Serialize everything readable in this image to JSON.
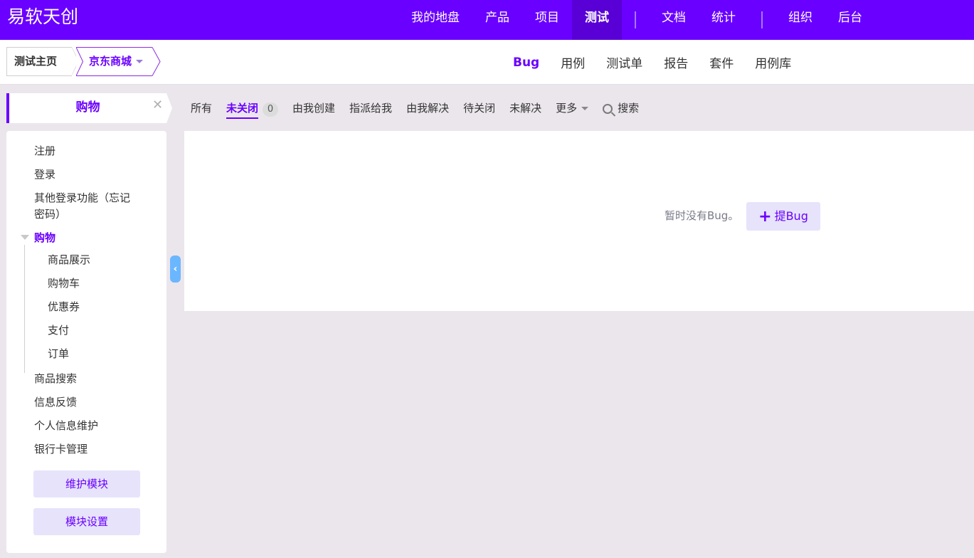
{
  "brand": "易软天创",
  "topnav": {
    "items": [
      "我的地盘",
      "产品",
      "项目",
      "测试",
      "文档",
      "统计",
      "组织",
      "后台"
    ],
    "active": "测试"
  },
  "breadcrumb": {
    "home": "测试主页",
    "product": "京东商城"
  },
  "subnav": {
    "items": [
      "Bug",
      "用例",
      "测试单",
      "报告",
      "套件",
      "用例库"
    ],
    "active": "Bug"
  },
  "module_panel": {
    "title": "购物",
    "tree": {
      "top_items": [
        "注册",
        "登录",
        "其他登录功能（忘记",
        "密码）"
      ],
      "group": "购物",
      "children": [
        "商品展示",
        "购物车",
        "优惠券",
        "支付",
        "订单"
      ],
      "bottom_items": [
        "商品搜索",
        "信息反馈",
        "个人信息维护",
        "银行卡管理"
      ]
    },
    "buttons": {
      "maintain": "维护模块",
      "settings": "模块设置"
    }
  },
  "filters": {
    "all": "所有",
    "unclosed": "未关闭",
    "unclosed_count": "0",
    "created_by_me": "由我创建",
    "assigned_to_me": "指派给我",
    "resolved_by_me": "由我解决",
    "to_close": "待关闭",
    "unresolved": "未解决",
    "more": "更多",
    "search": "搜索"
  },
  "empty": {
    "text": "暂时没有Bug。",
    "add_button": "提Bug"
  }
}
